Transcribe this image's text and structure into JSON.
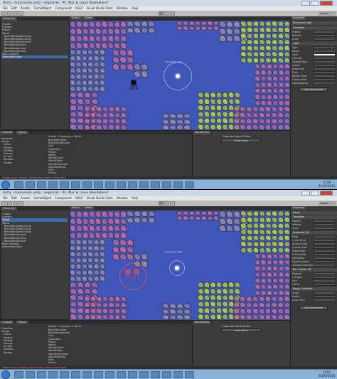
{
  "screens": [
    {
      "title": "Unity - mainscene.unity - organism - PC, Mac & Linux Standalone*",
      "menu": [
        "File",
        "Edit",
        "Assets",
        "GameObject",
        "Component",
        "NGUI",
        "Visual Studio Tools",
        "Window",
        "Help"
      ],
      "layout_dropdown": "Layout",
      "hierarchy_tab": "Hierarchy",
      "hierarchy_items": [
        "Create",
        "Camera",
        "Player",
        "World",
        "BlockTemplate(Clone)",
        "BlockTemplate(Clone)",
        "BlockTemplate(Clone)",
        "BlockBackground",
        "BlockBackground",
        "BlockBackground",
        "Main Camera",
        "Directional light"
      ],
      "hierarchy_selected": 11,
      "scene_tab": "Scene",
      "game_tab": "Game",
      "scene_label": "Directional light",
      "inspector_tab": "Inspector",
      "inspector_object": "Directional light",
      "inspector_sections": [
        "Transform",
        "Light"
      ],
      "inspector_fields": [
        "Position",
        "Rotation",
        "Scale",
        "Type",
        "Range",
        "Color",
        "Intensity",
        "Shadow Type",
        "Cookie",
        "Draw Halo",
        "Flare",
        "Render Mode",
        "Culling Mask",
        "Lightmapping"
      ],
      "add_component": "Add Component",
      "project_tab": "Project",
      "console_tab": "Console",
      "project_tree": [
        "Favorites",
        "Assets",
        "Editor",
        "Plugins",
        "Prefabs",
        "Scenes",
        "Scripts",
        "Shaders",
        "Sprites"
      ],
      "breadcrumb": "Assets > Organism > World",
      "project_files": [
        "BlockTemplate",
        "BlockBackground",
        "Cell",
        "Organism",
        "Player",
        "World",
        "WorldChunk",
        "WorldEditor",
        "WorldGenerator",
        "WorldSettings",
        "Utils",
        "Vector"
      ],
      "world_editor_tab": "WorldEditor",
      "world_editor_title": "Organism World Editor",
      "world_editor_button": "Create Block",
      "status_text": "Shader wants normals, but the mesh doesn't have them",
      "clock_time": "12:00",
      "clock_date": "21/05/2013"
    },
    {
      "title": "Unity - mainscene.unity - organism - PC, Mac & Linux Standalone*",
      "menu": [
        "File",
        "Edit",
        "Assets",
        "GameObject",
        "Component",
        "NGUI",
        "Visual Studio Tools",
        "Window",
        "Help"
      ],
      "layout_dropdown": "Layout",
      "hierarchy_tab": "Hierarchy",
      "hierarchy_items": [
        "Create",
        "Camera",
        "Player",
        "World",
        "BlockTemplate(Clone)",
        "BlockTemplate(Clone)",
        "BlockTemplate(Clone)",
        "BlockBackground",
        "BlockBackground",
        "BlockBackground",
        "Main Camera",
        "Directional light"
      ],
      "hierarchy_selected": 2,
      "scene_tab": "Scene",
      "game_tab": "Game",
      "scene_label": "Directional light",
      "inspector_tab": "Inspector",
      "inspector_object": "Player",
      "inspector_sections": [
        "Transform",
        "Rigidbody 2D",
        "Box Collider 2D",
        "Player Controller"
      ],
      "inspector_fields": [
        "Position",
        "Rotation",
        "Scale",
        "Mass",
        "Linear Drag",
        "Angular Drag",
        "Gravity Scale",
        "Fixed Angle",
        "Is Kinematic",
        "Interpolate",
        "Sleeping Mode",
        "Collision Detection",
        "Material",
        "Is Trigger",
        "Size",
        "Center",
        "Script",
        "Speed",
        "Jump Force"
      ],
      "add_component": "Add Component",
      "project_tab": "Project",
      "console_tab": "Console",
      "project_tree": [
        "Favorites",
        "Assets",
        "Editor",
        "Plugins",
        "Prefabs",
        "Scenes",
        "Scripts",
        "Shaders",
        "Sprites"
      ],
      "breadcrumb": "Assets > Organism > World",
      "project_files": [
        "BlockTemplate",
        "BlockBackground",
        "Cell",
        "Organism",
        "Player",
        "World",
        "WorldChunk",
        "WorldEditor",
        "WorldGenerator",
        "WorldSettings",
        "Utils",
        "Vector"
      ],
      "world_editor_tab": "WorldEditor",
      "world_editor_title": "Organism World Editor",
      "world_editor_button": "Create Block",
      "status_text": "Shader wants normals, but the mesh doesn't have them",
      "clock_time": "12:01",
      "clock_date": "21/05/2013"
    }
  ],
  "colors": {
    "water": "#3f55b8",
    "cell_pink": "#b26aa0",
    "cell_green": "#a8c84a",
    "cell_gray": "#8e8aa6",
    "selection": "#3d6aa8"
  }
}
